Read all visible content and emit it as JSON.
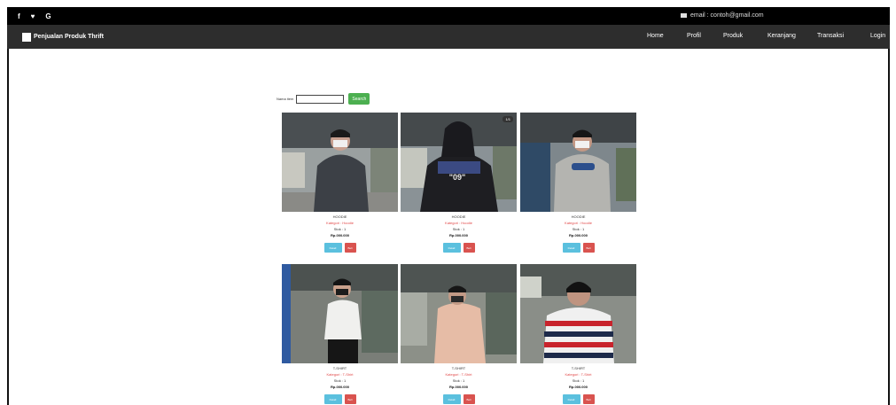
{
  "topbar": {
    "social": [
      "f",
      "♥",
      "G"
    ],
    "email": "email : contoh@gmail.com"
  },
  "navbar": {
    "brand": "Penjualan Produk Thrift",
    "items": [
      "Home",
      "Profil",
      "Produk",
      "Keranjang",
      "Transaksi",
      "Login"
    ]
  },
  "search": {
    "label": "Nama item",
    "placeholder": "",
    "button": "Search"
  },
  "products": [
    {
      "title": "HOODIE",
      "category": "Kategori : Hoodie",
      "stock": "Stok : 1",
      "price": "Rp.000.000",
      "detail": "Detail",
      "buy": "Beli",
      "badge": ""
    },
    {
      "title": "HOODIE",
      "category": "Kategori : Hoodie",
      "stock": "Stok : 1",
      "price": "Rp.000.000",
      "detail": "Detail",
      "buy": "Beli",
      "badge": "1/1"
    },
    {
      "title": "HOODIE",
      "category": "Kategori : Hoodie",
      "stock": "Stok : 1",
      "price": "Rp.000.000",
      "detail": "Detail",
      "buy": "Beli",
      "badge": ""
    },
    {
      "title": "T-SHIRT",
      "category": "Kategori : T-Shirt",
      "stock": "Stok : 1",
      "price": "Rp.000.000",
      "detail": "Detail",
      "buy": "Beli",
      "badge": ""
    },
    {
      "title": "T-SHIRT",
      "category": "Kategori : T-Shirt",
      "stock": "Stok : 1",
      "price": "Rp.000.000",
      "detail": "Detail",
      "buy": "Beli",
      "badge": ""
    },
    {
      "title": "T-SHIRT",
      "category": "Kategori : T-Shirt",
      "stock": "Stok : 1",
      "price": "Rp.000.000",
      "detail": "Detail",
      "buy": "Beli",
      "badge": ""
    }
  ],
  "colors": {
    "topbar": "#000000",
    "navbar": "#2d2d2d",
    "search_button": "#4caf50",
    "detail_button": "#5bc0de",
    "buy_button": "#d9534f",
    "category_text": "#e24a4a"
  }
}
